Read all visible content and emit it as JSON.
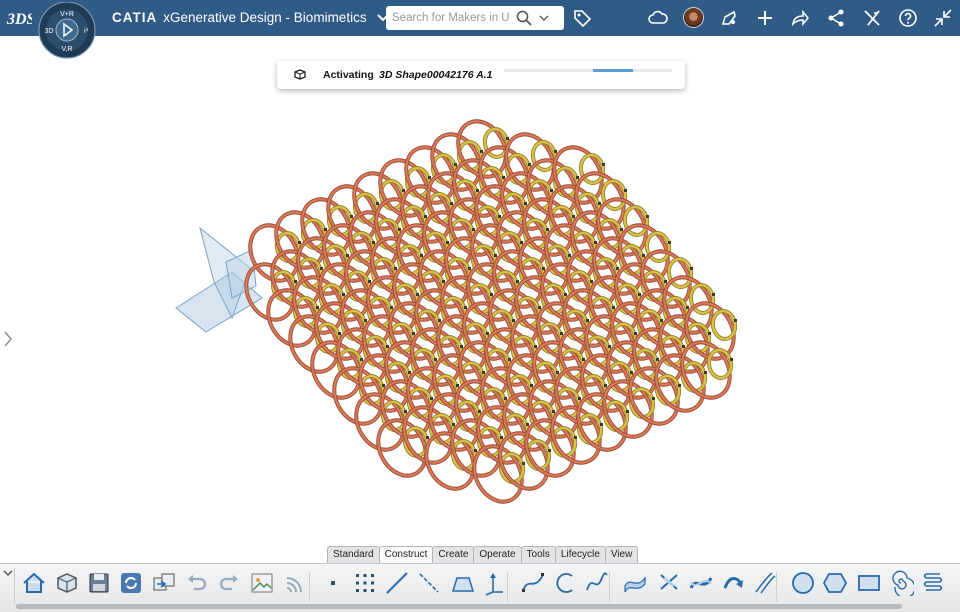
{
  "topbar": {
    "brand": "CATIA",
    "app_name": "xGenerative Design - Biomimetics",
    "compass": {
      "top_label": "V+R",
      "left_label": "3D",
      "right_label": "i³",
      "bottom_label": "V,R"
    },
    "search": {
      "placeholder": "Search for Makers in US",
      "value": ""
    },
    "icons": [
      "tag-icon",
      "cloud-icon",
      "avatar",
      "share-icon",
      "add-icon",
      "forward-icon",
      "network-share-icon",
      "tools-icon",
      "help-icon",
      "collapse-icon"
    ]
  },
  "activation": {
    "label": "Activating",
    "object": "3D Shape00042176 A.1",
    "progress_fraction": 0.4
  },
  "tabs": [
    {
      "label": "Standard"
    },
    {
      "label": "Construct",
      "active": true
    },
    {
      "label": "Create"
    },
    {
      "label": "Operate"
    },
    {
      "label": "Tools"
    },
    {
      "label": "Lifecycle"
    },
    {
      "label": "View"
    }
  ],
  "actionbar": {
    "icons": [
      "home-icon",
      "3d-part-icon",
      "save-icon",
      "refresh-icon",
      "swap-icon",
      "undo-icon",
      "redo-icon",
      "image-icon",
      "wifi-icon",
      "point-icon",
      "point-grid-icon",
      "line-icon",
      "axis-icon",
      "plane-icon",
      "axis-system-icon",
      "spline-icon",
      "arc-icon",
      "curve-icon",
      "sweep-icon",
      "blend-icon",
      "twist-icon",
      "rotate-icon",
      "parallel-curves-icon",
      "circle-icon",
      "hexagon-icon",
      "rectangle-icon",
      "spiral-icon",
      "spring-icon",
      "more-icon"
    ]
  },
  "colors": {
    "topbar": "#2f5b86",
    "ring_outer": "#d87a55",
    "ring_inner": "#d9c04a",
    "accent": "#5a9bd5"
  }
}
